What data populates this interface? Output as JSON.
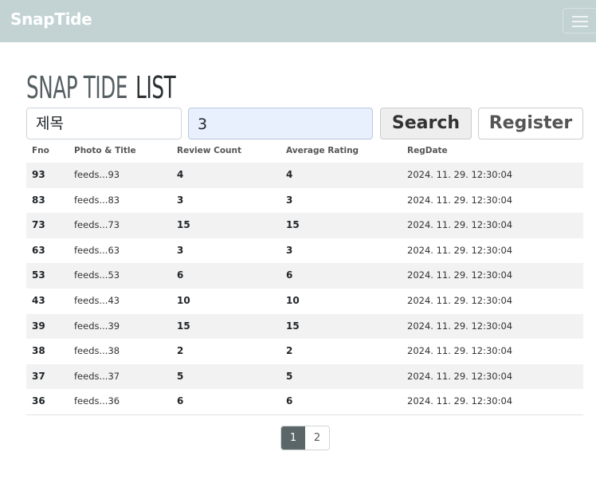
{
  "navbar": {
    "brand": "SnapTide"
  },
  "page": {
    "title_part1": "SNAP TIDE",
    "title_part2": "LIST"
  },
  "search": {
    "type_value": "제목",
    "keyword_value": "3",
    "search_label": "Search",
    "register_label": "Register"
  },
  "table": {
    "headers": {
      "fno": "Fno",
      "title": "Photo & Title",
      "review_count": "Review Count",
      "avg_rating": "Average Rating",
      "regdate": "RegDate"
    },
    "rows": [
      {
        "fno": "93",
        "title": "feeds...93",
        "review_count": "4",
        "avg_rating": "4",
        "regdate": "2024. 11. 29. 12:30:04"
      },
      {
        "fno": "83",
        "title": "feeds...83",
        "review_count": "3",
        "avg_rating": "3",
        "regdate": "2024. 11. 29. 12:30:04"
      },
      {
        "fno": "73",
        "title": "feeds...73",
        "review_count": "15",
        "avg_rating": "15",
        "regdate": "2024. 11. 29. 12:30:04"
      },
      {
        "fno": "63",
        "title": "feeds...63",
        "review_count": "3",
        "avg_rating": "3",
        "regdate": "2024. 11. 29. 12:30:04"
      },
      {
        "fno": "53",
        "title": "feeds...53",
        "review_count": "6",
        "avg_rating": "6",
        "regdate": "2024. 11. 29. 12:30:04"
      },
      {
        "fno": "43",
        "title": "feeds...43",
        "review_count": "10",
        "avg_rating": "10",
        "regdate": "2024. 11. 29. 12:30:04"
      },
      {
        "fno": "39",
        "title": "feeds...39",
        "review_count": "15",
        "avg_rating": "15",
        "regdate": "2024. 11. 29. 12:30:04"
      },
      {
        "fno": "38",
        "title": "feeds...38",
        "review_count": "2",
        "avg_rating": "2",
        "regdate": "2024. 11. 29. 12:30:04"
      },
      {
        "fno": "37",
        "title": "feeds...37",
        "review_count": "5",
        "avg_rating": "5",
        "regdate": "2024. 11. 29. 12:30:04"
      },
      {
        "fno": "36",
        "title": "feeds...36",
        "review_count": "6",
        "avg_rating": "6",
        "regdate": "2024. 11. 29. 12:30:04"
      }
    ]
  },
  "pagination": {
    "pages": [
      "1",
      "2"
    ],
    "active": "1"
  },
  "colors": {
    "navbar_bg": "#c3d3d3",
    "active_page_bg": "#5b6668",
    "keyword_input_bg": "#e8f0fe"
  },
  "icons": {
    "menu": "hamburger-menu-icon"
  }
}
